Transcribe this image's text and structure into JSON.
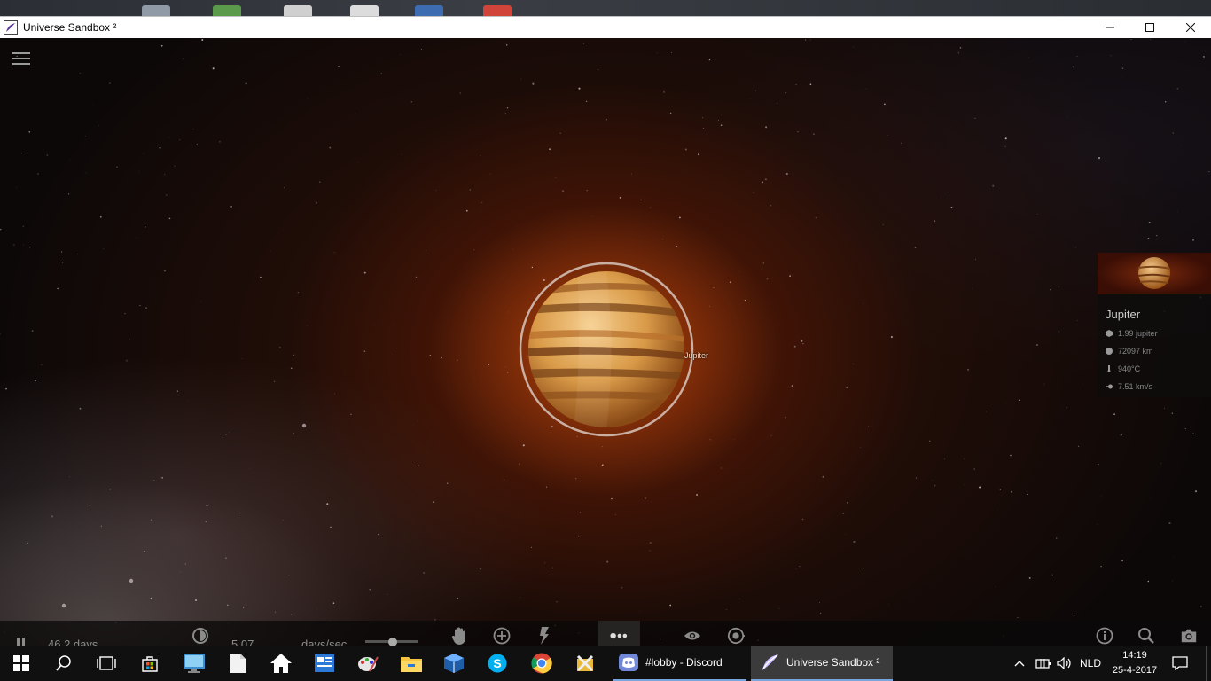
{
  "window": {
    "title": "Universe Sandbox ²",
    "controls": [
      "minimize-icon",
      "maximize-icon",
      "close-icon"
    ]
  },
  "viewport": {
    "menu_icon": "hamburger-icon",
    "planet_label": "Jupiter"
  },
  "info_panel": {
    "name": "Jupiter",
    "stats": [
      {
        "icon": "mass-icon",
        "value": "1.99 jupiter"
      },
      {
        "icon": "radius-icon",
        "value": "72097 km"
      },
      {
        "icon": "temperature-icon",
        "value": "940°C"
      },
      {
        "icon": "velocity-icon",
        "value": "7.51 km/s"
      }
    ]
  },
  "toolbar": {
    "elapsed": "46.2 days",
    "speed_value": "5.07",
    "speed_unit": "days/sec",
    "icons": [
      "pause-icon",
      "clock-icon",
      "hand-icon",
      "add-icon",
      "power-icon",
      "people-icon",
      "eye-icon",
      "sim-icon",
      "info-icon",
      "search-icon",
      "camera-icon"
    ]
  },
  "taskbar": {
    "apps": [
      {
        "label": "#lobby - Discord",
        "icon": "discord-icon"
      },
      {
        "label": "Universe Sandbox ²",
        "icon": "universe-sandbox-icon"
      }
    ],
    "language": "NLD",
    "time": "14:19",
    "date": "25-4-2017"
  },
  "colors": {
    "accent": "#76a6dd",
    "planet_glow": "#e66414",
    "taskbar": "#101010"
  }
}
